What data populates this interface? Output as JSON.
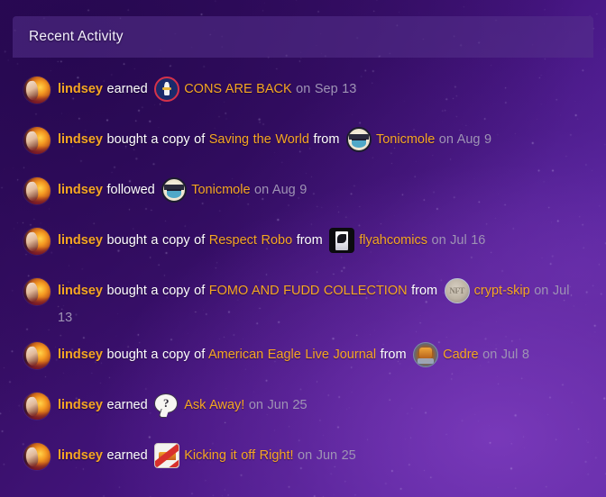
{
  "page": {
    "title": "Recent Activity",
    "background_top_left": "#2a0a52",
    "background_bottom_right": "#5e2aa8",
    "header_panel_color": "#563280",
    "accent_color": "#f5a623",
    "text_color": "#ffffff",
    "date_color": "#9e93b4"
  },
  "header": {
    "title": "Recent Activity"
  },
  "feed": {
    "rows": [
      {
        "avatar_name": "avatar-lindsey",
        "user": "lindsey",
        "verb": "earned",
        "item": "CONS ARE BACK",
        "item_thumb_name": "badge-cons-are-back",
        "from_label": null,
        "seller": null,
        "seller_thumb_name": null,
        "date": "on Sep 13"
      },
      {
        "avatar_name": "avatar-lindsey",
        "user": "lindsey",
        "verb": "bought a copy of",
        "item": "Saving the World",
        "item_thumb_name": null,
        "from_label": "from",
        "seller": "Tonicmole",
        "seller_thumb_name": "avatar-tonicmole",
        "date": "on Aug 9"
      },
      {
        "avatar_name": "avatar-lindsey",
        "user": "lindsey",
        "verb": "followed",
        "item": null,
        "item_thumb_name": null,
        "from_label": null,
        "seller": "Tonicmole",
        "seller_thumb_name": "avatar-tonicmole",
        "date": "on Aug 9"
      },
      {
        "avatar_name": "avatar-lindsey",
        "user": "lindsey",
        "verb": "bought a copy of",
        "item": "Respect Robo",
        "item_thumb_name": null,
        "from_label": "from",
        "seller": "flyahcomics",
        "seller_thumb_name": "avatar-flyahcomics",
        "date": "on Jul 16"
      },
      {
        "avatar_name": "avatar-lindsey",
        "user": "lindsey",
        "verb": "bought a copy of",
        "item": "FOMO AND FUDD COLLECTION",
        "item_thumb_name": null,
        "from_label": "from",
        "seller": "crypt-skip",
        "seller_thumb_name": "avatar-crypt-skip",
        "date": "on Jul 13"
      },
      {
        "avatar_name": "avatar-lindsey",
        "user": "lindsey",
        "verb": "bought a copy of",
        "item": "American Eagle Live Journal",
        "item_thumb_name": null,
        "from_label": "from",
        "seller": "Cadre",
        "seller_thumb_name": "avatar-cadre",
        "date": "on Jul 8"
      },
      {
        "avatar_name": "avatar-lindsey",
        "user": "lindsey",
        "verb": "earned",
        "item": "Ask Away!",
        "item_thumb_name": "badge-ask-away",
        "from_label": null,
        "seller": null,
        "seller_thumb_name": null,
        "date": "on Jun 25"
      },
      {
        "avatar_name": "avatar-lindsey",
        "user": "lindsey",
        "verb": "earned",
        "item": "Kicking it off Right!",
        "item_thumb_name": "badge-kicking-it-off-right",
        "from_label": null,
        "seller": null,
        "seller_thumb_name": null,
        "date": "on Jun 25"
      }
    ]
  }
}
